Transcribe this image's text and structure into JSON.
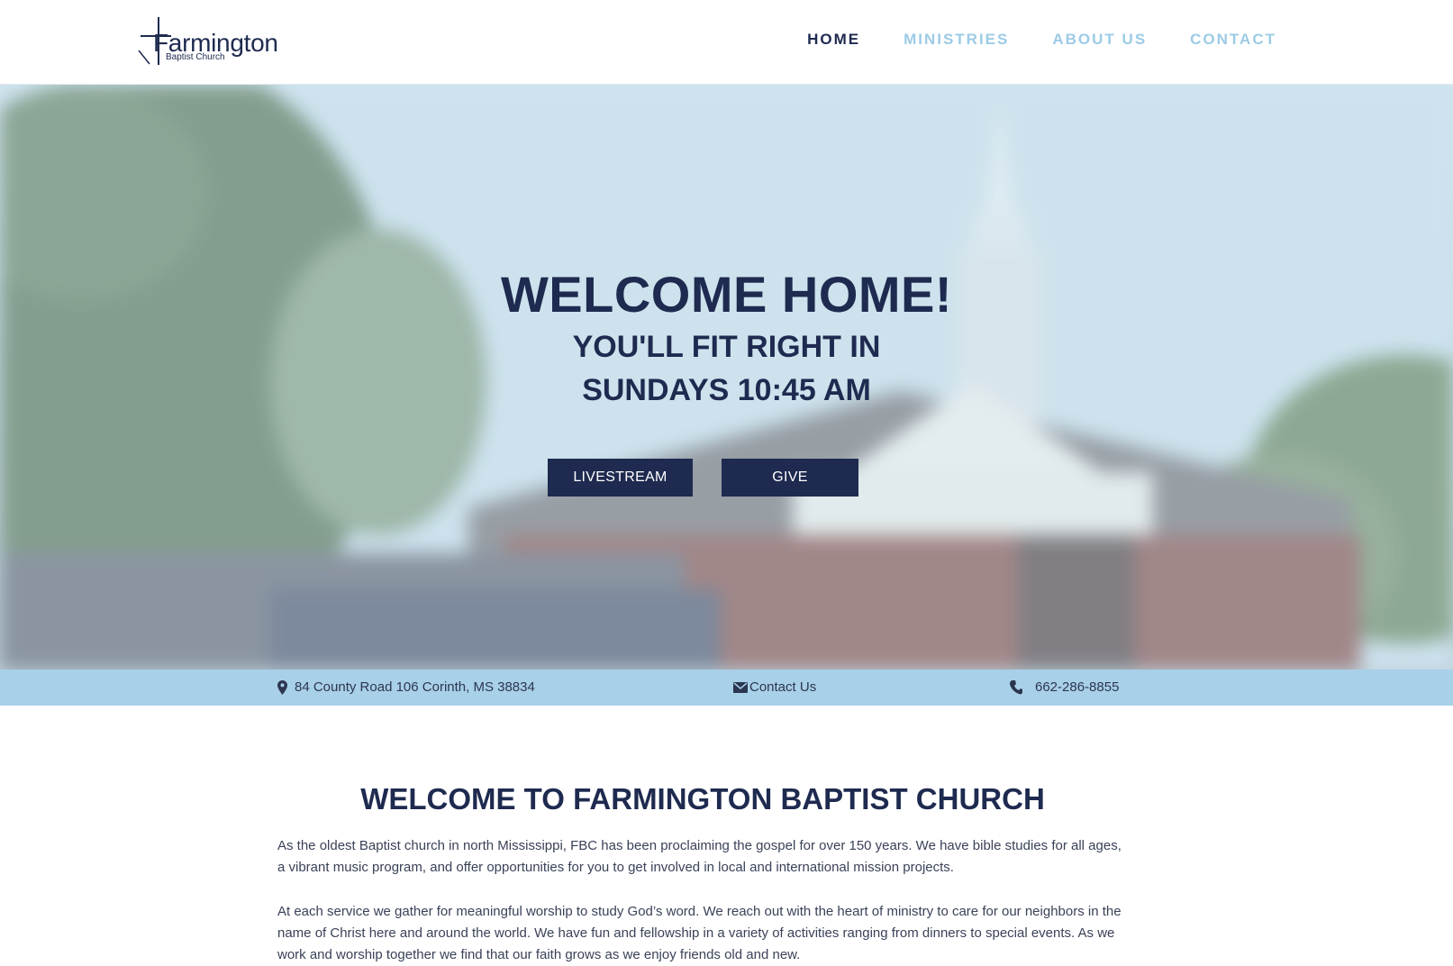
{
  "header": {
    "logo": {
      "name": "Farmington",
      "sub": "Baptist Church"
    },
    "nav": [
      {
        "label": "HOME",
        "active": true
      },
      {
        "label": "MINISTRIES",
        "active": false
      },
      {
        "label": "ABOUT US",
        "active": false
      },
      {
        "label": "CONTACT",
        "active": false
      }
    ]
  },
  "hero": {
    "title": "WELCOME HOME!",
    "subtitle_1": "YOU'LL FIT RIGHT IN",
    "subtitle_2": "SUNDAYS 10:45 AM",
    "buttons": {
      "livestream": "LIVESTREAM",
      "give": "GIVE"
    }
  },
  "infobar": {
    "address": "84 County Road 106 Corinth, MS 38834",
    "contact": "Contact Us",
    "phone": "662-286-8855",
    "icons": {
      "address": "map-pin-icon",
      "contact": "envelope-icon",
      "phone": "phone-icon"
    }
  },
  "welcome": {
    "title": "WELCOME TO FARMINGTON BAPTIST CHURCH",
    "paragraph_1": "As the oldest Baptist church in north Mississippi, FBC has been proclaiming the gospel for over 150 years.  We have bible studies for all ages, a vibrant music program, and offer opportunities for you to get involved in local and international mission projects.",
    "paragraph_2": "At each service we gather for meaningful worship to study God’s word. We reach out with the heart of ministry to care for our neighbors in the name of Christ here and around the world. We have fun and fellowship in a variety of activities ranging from dinners to special events. As we work and worship together we find that our faith grows as we enjoy friends old and new."
  },
  "colors": {
    "navy": "#1e2a4f",
    "nav_inactive": "#9ccbe6",
    "infobar_bg": "#a8d0e8"
  }
}
